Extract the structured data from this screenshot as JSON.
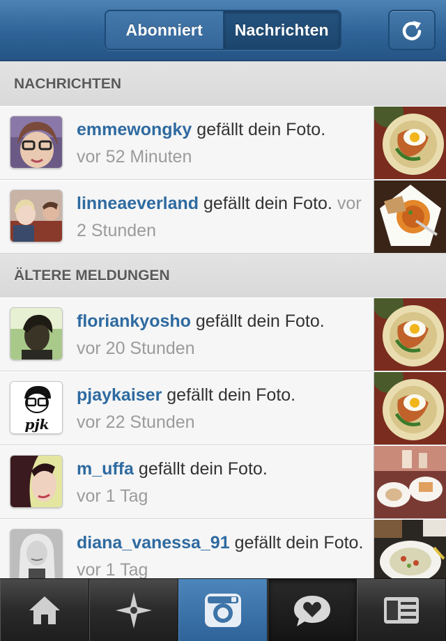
{
  "header": {
    "tabs": [
      {
        "label": "Abonniert",
        "active": false
      },
      {
        "label": "Nachrichten",
        "active": true
      }
    ],
    "refresh_icon": "refresh-icon"
  },
  "sections": [
    {
      "title": "NACHRICHTEN"
    },
    {
      "title": "ÄLTERE MELDUNGEN"
    }
  ],
  "notifications": [
    {
      "user": "emmewongky",
      "action": "gefällt dein Foto.",
      "time": "vor 52 Minuten"
    },
    {
      "user": "linneaeverland",
      "action": "gefällt dein Foto.",
      "time": "vor 2 Stunden"
    },
    {
      "user": "floriankyosho",
      "action": "gefällt dein Foto.",
      "time": "vor 20 Stunden"
    },
    {
      "user": "pjaykaiser",
      "action": "gefällt dein Foto.",
      "time": "vor 22 Stunden"
    },
    {
      "user": "m_uffa",
      "action": "gefällt dein Foto.",
      "time": "vor 1 Tag"
    },
    {
      "user": "diana_vanessa_91",
      "action": "gefällt dein Foto.",
      "time": "vor 1 Tag"
    }
  ],
  "avatar_text": {
    "pjaykaiser": "pjk"
  },
  "tabbar": {
    "items": [
      "home-icon",
      "explore-icon",
      "camera-icon",
      "activity-icon",
      "profile-icon"
    ],
    "active": "activity-icon"
  },
  "colors": {
    "header_blue": "#2f6397",
    "username_blue": "#2e6aa0",
    "timestamp_gray": "#9b9b9b"
  }
}
